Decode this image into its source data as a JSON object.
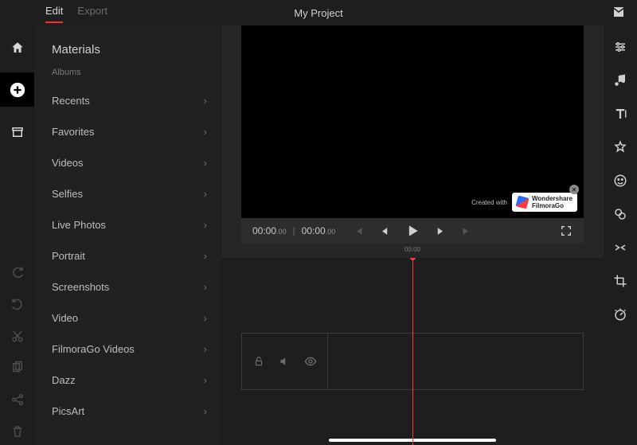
{
  "header": {
    "tabs": {
      "edit": "Edit",
      "export": "Export"
    },
    "title": "My Project"
  },
  "sidebar": {
    "title": "Materials",
    "subtitle": "Albums",
    "items": [
      {
        "label": "Recents"
      },
      {
        "label": "Favorites"
      },
      {
        "label": "Videos"
      },
      {
        "label": "Selfies"
      },
      {
        "label": "Live Photos"
      },
      {
        "label": "Portrait"
      },
      {
        "label": "Screenshots"
      },
      {
        "label": "Video"
      },
      {
        "label": "FilmoraGo Videos"
      },
      {
        "label": "Dazz"
      },
      {
        "label": "PicsArt"
      }
    ]
  },
  "player": {
    "current_sec": "00:00",
    "current_ms": ".00",
    "total_sec": "00:00",
    "total_ms": ".00"
  },
  "timeline": {
    "tick_label": "00:00"
  },
  "watermark": {
    "prefix": "Created with",
    "line1": "Wondershare",
    "line2": "FilmoraGo"
  },
  "icons": {
    "chevron": "›"
  }
}
